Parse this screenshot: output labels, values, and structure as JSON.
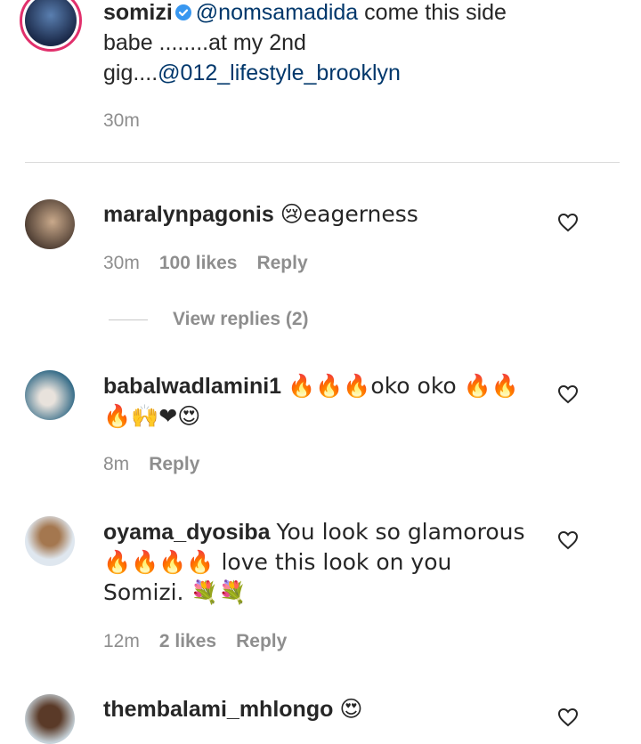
{
  "caption": {
    "username": "somizi",
    "verified": true,
    "mention1": "@nomsamadida",
    "text1": " come this side babe ........at my 2nd gig....",
    "mention2": "@012_lifestyle_brooklyn",
    "time": "30m"
  },
  "comments": [
    {
      "username": "maralynpagonis",
      "text": "😢eagerness",
      "time": "30m",
      "likes": "100 likes",
      "reply": "Reply",
      "view_replies": "View replies (2)"
    },
    {
      "username": "babalwadlamini1",
      "text": "🔥🔥🔥oko oko 🔥🔥 🔥🙌❤😍",
      "time": "8m",
      "reply": "Reply"
    },
    {
      "username": "oyama_dyosiba",
      "text": "You look so glamorous 🔥🔥🔥🔥 love this look on you Somizi. 💐💐",
      "time": "12m",
      "likes": "2 likes",
      "reply": "Reply"
    },
    {
      "username": "thembalami_mhlongo",
      "text": "😍"
    }
  ],
  "colors": {
    "text": "#262626",
    "secondary": "#8e8e8e",
    "mention": "#00376b",
    "verified": "#3897f0"
  },
  "icons": [
    "verified-badge-icon",
    "heart-outline-icon"
  ]
}
